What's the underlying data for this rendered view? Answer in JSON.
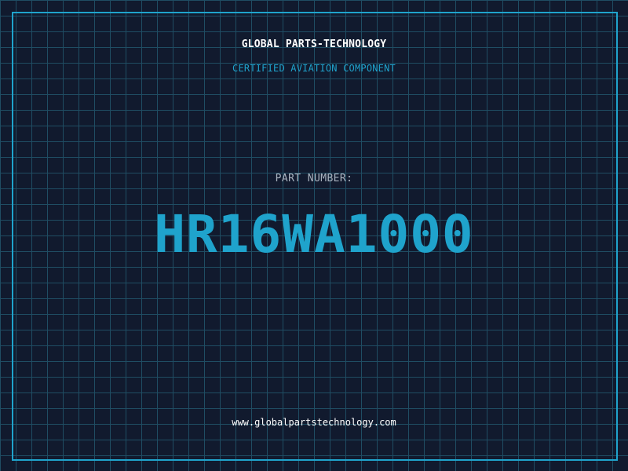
{
  "header": {
    "company_name": "GLOBAL PARTS-TECHNOLOGY",
    "tagline": "CERTIFIED AVIATION COMPONENT"
  },
  "part": {
    "label": "PART NUMBER:",
    "number": "HR16WA1000"
  },
  "footer": {
    "website": "www.globalpartstechnology.com"
  },
  "colors": {
    "background": "#111a2e",
    "grid": "#1f4d63",
    "accent": "#1fa3cc",
    "text_primary": "#ffffff",
    "text_muted": "#aab4c0"
  }
}
